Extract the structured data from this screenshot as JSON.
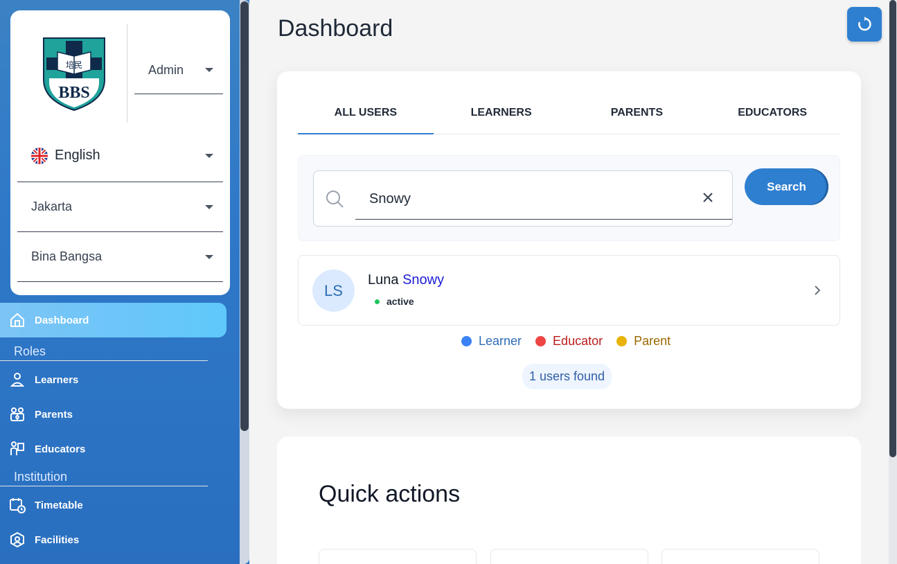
{
  "sidebar": {
    "logo_text": "BBS",
    "logo_chars": "培民",
    "role_select": "Admin",
    "language": "English",
    "city": "Jakarta",
    "school": "Bina Bangsa",
    "nav": {
      "dashboard": "Dashboard",
      "roles_header": "Roles",
      "learners": "Learners",
      "parents": "Parents",
      "educators": "Educators",
      "institution_header": "Institution",
      "timetable": "Timetable",
      "facilities": "Facilities"
    }
  },
  "main": {
    "title": "Dashboard",
    "tabs": [
      "ALL USERS",
      "LEARNERS",
      "PARENTS",
      "EDUCATORS"
    ],
    "search": {
      "value": "Snowy",
      "button": "Search"
    },
    "result": {
      "initials": "LS",
      "first": "Luna",
      "last": "Snowy",
      "status": "active"
    },
    "legend": [
      {
        "label": "Learner",
        "color": "#3b82f6",
        "text_color": "#2f6bb5"
      },
      {
        "label": "Educator",
        "color": "#ef4444",
        "text_color": "#b91c1c"
      },
      {
        "label": "Parent",
        "color": "#eab308",
        "text_color": "#9a6700"
      }
    ],
    "found": "1 users found",
    "quick_actions": "Quick actions"
  },
  "colors": {
    "accent": "#2f7fd0",
    "sidebar": "#2f78c8",
    "active_nav": "#5fc8fb"
  }
}
